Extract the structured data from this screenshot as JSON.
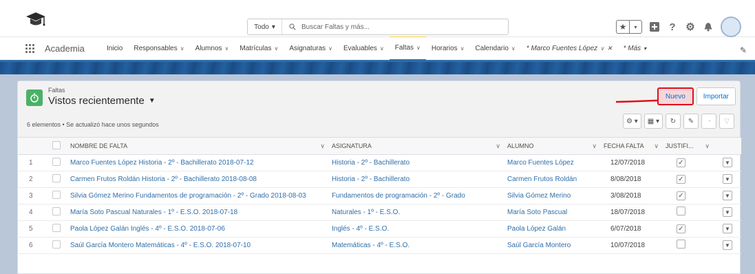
{
  "header": {
    "scope_label": "Todo",
    "search_placeholder": "Buscar Faltas y más...",
    "help_icon": "?"
  },
  "nav": {
    "app_name": "Academia",
    "items": [
      {
        "label": "Inicio",
        "chevron": false
      },
      {
        "label": "Responsables",
        "chevron": true
      },
      {
        "label": "Alumnos",
        "chevron": true
      },
      {
        "label": "Matrículas",
        "chevron": true
      },
      {
        "label": "Asignaturas",
        "chevron": true
      },
      {
        "label": "Evaluables",
        "chevron": true
      },
      {
        "label": "Faltas",
        "chevron": true,
        "active": true
      },
      {
        "label": "Horarios",
        "chevron": true
      },
      {
        "label": "Calendario",
        "chevron": true
      },
      {
        "label": "* Marco Fuentes López",
        "chevron": true,
        "close": true,
        "italic": true
      },
      {
        "label": "* Más",
        "italic": true
      }
    ]
  },
  "list": {
    "object_label": "Faltas",
    "title": "Vistos recientemente",
    "meta": "6 elementos • Se actualizó hace unos segundos",
    "new_button": "Nuevo",
    "import_button": "Importar",
    "columns": [
      "NOMBRE DE FALTA",
      "ASIGNATURA",
      "ALUMNO",
      "FECHA FALTA",
      "JUSTIFI..."
    ],
    "rows": [
      {
        "n": "1",
        "nombre": "Marco Fuentes López Historia - 2º - Bachillerato 2018-07-12",
        "asignatura": "Historia - 2º - Bachillerato",
        "alumno": "Marco Fuentes López",
        "fecha": "12/07/2018",
        "justificada": true
      },
      {
        "n": "2",
        "nombre": "Carmen Frutos Roldán Historia - 2º - Bachillerato 2018-08-08",
        "asignatura": "Historia - 2º - Bachillerato",
        "alumno": "Carmen Frutos Roldán",
        "fecha": "8/08/2018",
        "justificada": true
      },
      {
        "n": "3",
        "nombre": "Silvia Gómez Merino Fundamentos de programación - 2º - Grado 2018-08-03",
        "asignatura": "Fundamentos de programación - 2º - Grado",
        "alumno": "Silvia Gómez Merino",
        "fecha": "3/08/2018",
        "justificada": true
      },
      {
        "n": "4",
        "nombre": "María Soto Pascual Naturales - 1º - E.S.O. 2018-07-18",
        "asignatura": "Naturales - 1º - E.S.O.",
        "alumno": "María Soto Pascual",
        "fecha": "18/07/2018",
        "justificada": false
      },
      {
        "n": "5",
        "nombre": "Paola López Galán Inglés - 4º - E.S.O. 2018-07-06",
        "asignatura": "Inglés - 4º - E.S.O.",
        "alumno": "Paola López Galán",
        "fecha": "6/07/2018",
        "justificada": true
      },
      {
        "n": "6",
        "nombre": "Saúl García Montero Matemáticas - 4º - E.S.O. 2018-07-10",
        "asignatura": "Matemáticas - 4º - E.S.O.",
        "alumno": "Saúl García Montero",
        "fecha": "10/07/2018",
        "justificada": false
      }
    ]
  },
  "colors": {
    "accent": "#2f6ea8",
    "highlight": "#e10e1a",
    "object_icon": "#4bb167"
  }
}
